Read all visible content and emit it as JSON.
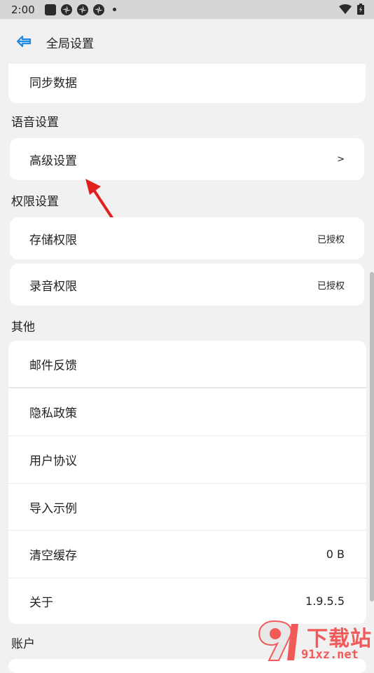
{
  "status_bar": {
    "time": "2:00"
  },
  "header": {
    "title": "全局设置"
  },
  "top_card": {
    "label": "同步数据"
  },
  "sections": {
    "voice": "语音设置",
    "permissions": "权限设置",
    "other": "其他",
    "account": "账户"
  },
  "voice_items": [
    {
      "label": "高级设置",
      "value": ">"
    }
  ],
  "permission_items": [
    {
      "label": "存储权限",
      "value": "已授权"
    },
    {
      "label": "录音权限",
      "value": "已授权"
    }
  ],
  "other_items": [
    {
      "label": "邮件反馈",
      "value": ""
    },
    {
      "label": "隐私政策",
      "value": ""
    },
    {
      "label": "用户协议",
      "value": ""
    },
    {
      "label": "导入示例",
      "value": ""
    },
    {
      "label": "清空缓存",
      "value": "0 B"
    },
    {
      "label": "关于",
      "value": "1.9.5.5"
    }
  ],
  "watermark": {
    "text": "91xz.net",
    "title": "下载站"
  },
  "colors": {
    "accent": "#1e88e5",
    "arrow": "#e21f1f"
  }
}
